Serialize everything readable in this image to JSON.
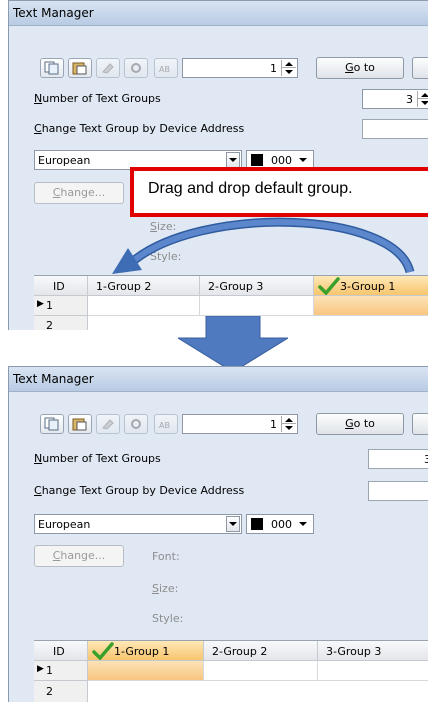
{
  "window": {
    "title": "Text Manager"
  },
  "toolbar": {
    "icons": [
      "copy-icon",
      "paste-icon",
      "clear-icon",
      "settings-icon",
      "toggle-case-icon"
    ],
    "spinner_value": "1",
    "goto_label_pre": "",
    "goto_label_u": "G",
    "goto_label_post": "o to"
  },
  "num_groups": {
    "label_u": "N",
    "label_rest": "umber of Text Groups",
    "value": "3"
  },
  "change_by_device": {
    "label_u": "C",
    "label_rest": "hange Text Group by Device Address"
  },
  "font_settings": {
    "language": "European",
    "color_value": "000",
    "change_u": "C",
    "change_rest": "hange...",
    "font_label": "Font:",
    "size_u": "S",
    "size_rest": "ize:",
    "style_label": "Style:"
  },
  "callout": {
    "text": "Drag and drop default group."
  },
  "top_table": {
    "headers": [
      "ID",
      "1-Group 2",
      "2-Group 3",
      "3-Group 1"
    ],
    "default_column": 3,
    "rows": [
      "1",
      "2"
    ]
  },
  "bottom_table": {
    "headers": [
      "ID",
      "1-Group 1",
      "2-Group 2",
      "3-Group 3"
    ],
    "default_column": 1,
    "rows": [
      "1",
      "2"
    ]
  },
  "colors": {
    "callout_border": "#e00000",
    "arrow_fill": "#4f7ac0",
    "selected_cell": "#f8c67f",
    "check": "#3aa02c"
  }
}
